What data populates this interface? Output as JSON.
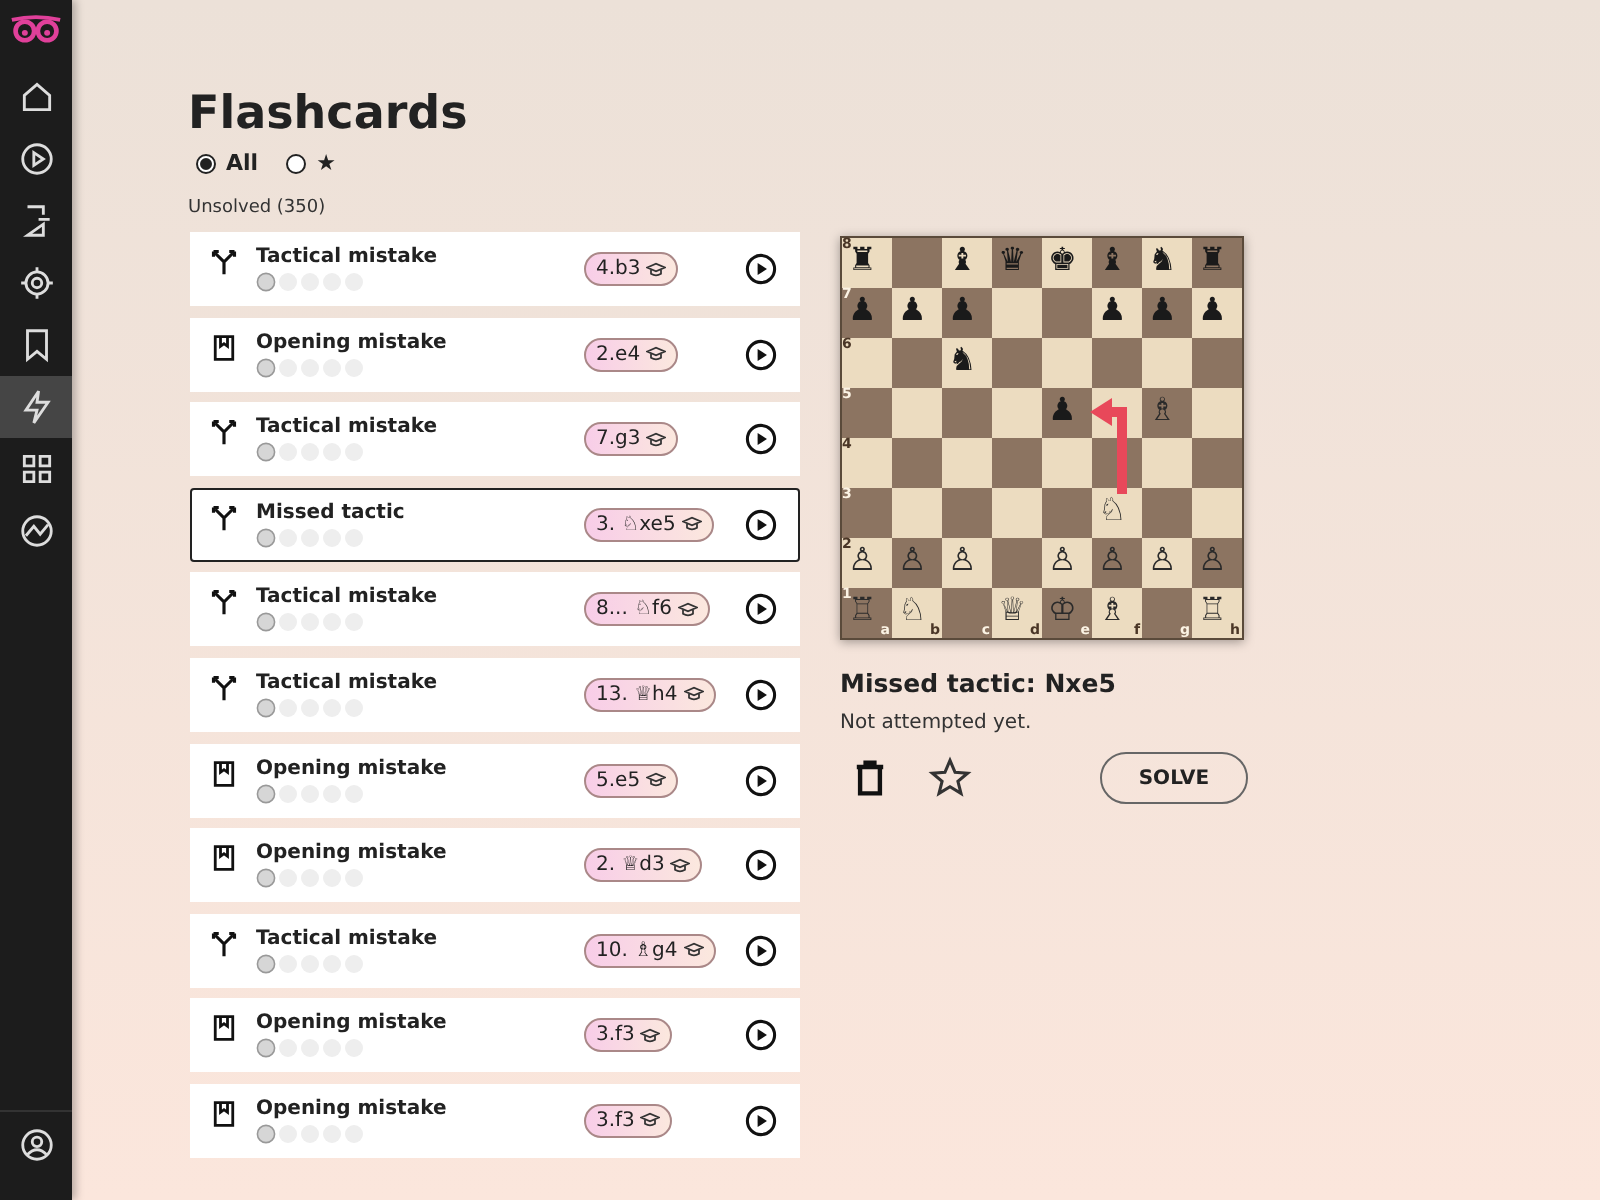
{
  "sidebar": {
    "items": [
      {
        "selected": false
      },
      {
        "selected": false
      },
      {
        "selected": false
      },
      {
        "selected": false
      },
      {
        "selected": false
      },
      {
        "selected": true
      },
      {
        "selected": false
      },
      {
        "selected": false
      }
    ]
  },
  "title": "Flashcards",
  "filters": [
    {
      "label": "All",
      "selected": true
    },
    {
      "label": "★",
      "selected": false
    }
  ],
  "section_label": "Unsolved (350)",
  "cards": [
    {
      "kind": "tactic",
      "title": "Tactical mistake",
      "move": "4.b3",
      "selected": false
    },
    {
      "kind": "opening",
      "title": "Opening mistake",
      "move": "2.e4",
      "selected": false
    },
    {
      "kind": "tactic",
      "title": "Tactical mistake",
      "move": "7.g3",
      "selected": false
    },
    {
      "kind": "tactic",
      "title": "Missed tactic",
      "move": "3. ♘xe5",
      "selected": true
    },
    {
      "kind": "tactic",
      "title": "Tactical mistake",
      "move": "8... ♘f6",
      "selected": false
    },
    {
      "kind": "tactic",
      "title": "Tactical mistake",
      "move": "13. ♕h4",
      "selected": false
    },
    {
      "kind": "opening",
      "title": "Opening mistake",
      "move": "5.e5",
      "selected": false
    },
    {
      "kind": "opening",
      "title": "Opening mistake",
      "move": "2. ♕d3",
      "selected": false
    },
    {
      "kind": "tactic",
      "title": "Tactical mistake",
      "move": "10. ♗g4",
      "selected": false
    },
    {
      "kind": "opening",
      "title": "Opening mistake",
      "move": "3.f3",
      "selected": false
    },
    {
      "kind": "opening",
      "title": "Opening mistake",
      "move": "3.f3",
      "selected": false
    }
  ],
  "board": {
    "ranks": [
      [
        {
          "kind": "piece",
          "piece": "♜"
        },
        {
          "kind": "empty"
        },
        {
          "kind": "piece",
          "piece": "♝"
        },
        {
          "kind": "piece",
          "piece": "♛"
        },
        {
          "kind": "piece",
          "piece": "♚"
        },
        {
          "kind": "piece",
          "piece": "♝"
        },
        {
          "kind": "piece",
          "piece": "♞"
        },
        {
          "kind": "piece",
          "piece": "♜"
        }
      ],
      [
        {
          "kind": "piece",
          "piece": "♟"
        },
        {
          "kind": "piece",
          "piece": "♟"
        },
        {
          "kind": "piece",
          "piece": "♟"
        },
        {
          "kind": "empty"
        },
        {
          "kind": "empty"
        },
        {
          "kind": "piece",
          "piece": "♟"
        },
        {
          "kind": "piece",
          "piece": "♟"
        },
        {
          "kind": "piece",
          "piece": "♟"
        }
      ],
      [
        {
          "kind": "empty"
        },
        {
          "kind": "empty"
        },
        {
          "kind": "piece",
          "piece": "♞"
        },
        {
          "kind": "empty"
        },
        {
          "kind": "empty"
        },
        {
          "kind": "empty"
        },
        {
          "kind": "empty"
        },
        {
          "kind": "empty"
        }
      ],
      [
        {
          "kind": "empty"
        },
        {
          "kind": "empty"
        },
        {
          "kind": "empty"
        },
        {
          "kind": "empty"
        },
        {
          "kind": "piece",
          "piece": "♟"
        },
        {
          "kind": "empty"
        },
        {
          "kind": "piece",
          "piece": "♗"
        },
        {
          "kind": "empty"
        }
      ],
      [
        {
          "kind": "empty"
        },
        {
          "kind": "empty"
        },
        {
          "kind": "empty"
        },
        {
          "kind": "empty"
        },
        {
          "kind": "empty"
        },
        {
          "kind": "empty"
        },
        {
          "kind": "empty"
        },
        {
          "kind": "empty"
        }
      ],
      [
        {
          "kind": "empty"
        },
        {
          "kind": "empty"
        },
        {
          "kind": "empty"
        },
        {
          "kind": "empty"
        },
        {
          "kind": "empty"
        },
        {
          "kind": "piece",
          "piece": "♘"
        },
        {
          "kind": "empty"
        },
        {
          "kind": "empty"
        }
      ],
      [
        {
          "kind": "piece",
          "piece": "♙"
        },
        {
          "kind": "piece",
          "piece": "♙"
        },
        {
          "kind": "piece",
          "piece": "♙"
        },
        {
          "kind": "empty"
        },
        {
          "kind": "piece",
          "piece": "♙"
        },
        {
          "kind": "piece",
          "piece": "♙"
        },
        {
          "kind": "piece",
          "piece": "♙"
        },
        {
          "kind": "piece",
          "piece": "♙"
        }
      ],
      [
        {
          "kind": "piece",
          "piece": "♖"
        },
        {
          "kind": "piece",
          "piece": "♘"
        },
        {
          "kind": "empty"
        },
        {
          "kind": "piece",
          "piece": "♕"
        },
        {
          "kind": "piece",
          "piece": "♔"
        },
        {
          "kind": "piece",
          "piece": "♗"
        },
        {
          "kind": "empty"
        },
        {
          "kind": "piece",
          "piece": "♖"
        }
      ]
    ],
    "rank_labels": [
      "8",
      "7",
      "6",
      "5",
      "4",
      "3",
      "2",
      "1"
    ],
    "file_labels": [
      "a",
      "b",
      "c",
      "d",
      "e",
      "f",
      "g",
      "h"
    ]
  },
  "detail": {
    "title": "Missed tactic: Nxe5",
    "status": "Not attempted yet.",
    "solve_button": "SOLVE"
  }
}
